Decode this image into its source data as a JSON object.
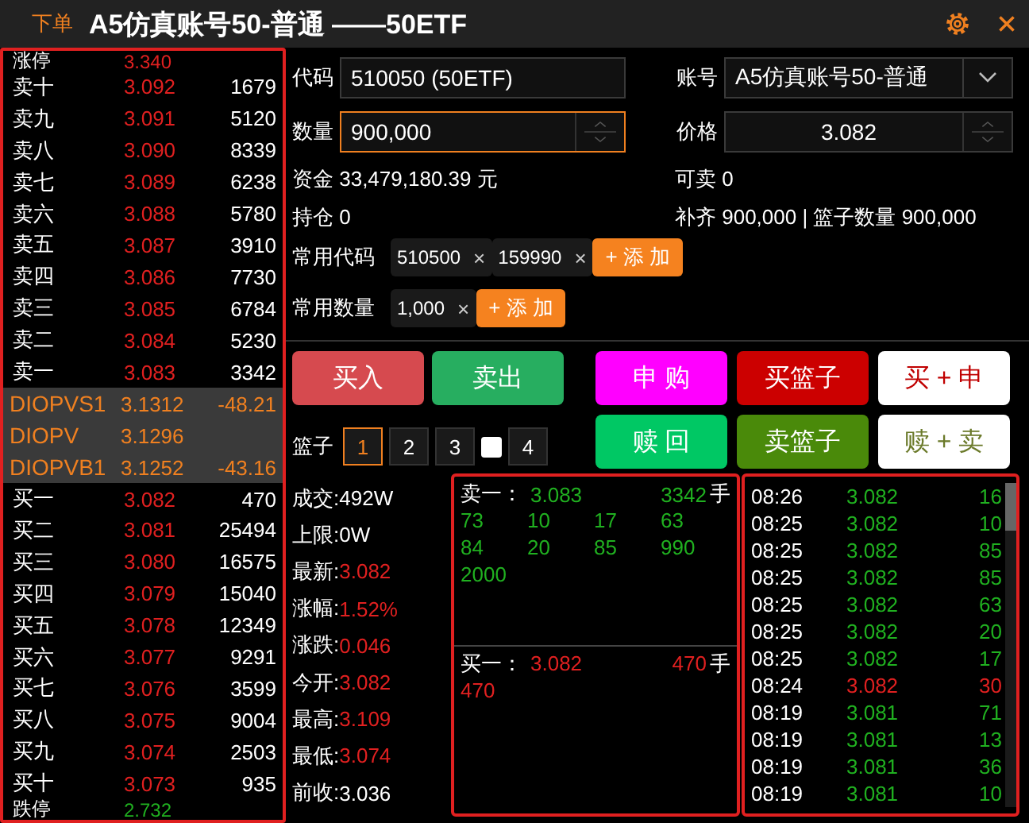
{
  "window": {
    "menu": "下单",
    "title": "A5仿真账号50-普通 ——50ETF"
  },
  "order_book": {
    "limit_up": {
      "label": "涨停",
      "price": "3.340",
      "color": "#e02020"
    },
    "asks": [
      {
        "label": "卖十",
        "price": "3.092",
        "volume": "1679"
      },
      {
        "label": "卖九",
        "price": "3.091",
        "volume": "5120"
      },
      {
        "label": "卖八",
        "price": "3.090",
        "volume": "8339"
      },
      {
        "label": "卖七",
        "price": "3.089",
        "volume": "6238"
      },
      {
        "label": "卖六",
        "price": "3.088",
        "volume": "5780"
      },
      {
        "label": "卖五",
        "price": "3.087",
        "volume": "3910"
      },
      {
        "label": "卖四",
        "price": "3.086",
        "volume": "7730"
      },
      {
        "label": "卖三",
        "price": "3.085",
        "volume": "6784"
      },
      {
        "label": "卖二",
        "price": "3.084",
        "volume": "5230"
      },
      {
        "label": "卖一",
        "price": "3.083",
        "volume": "3342"
      }
    ],
    "iopv": [
      {
        "label": "DIOPVS1",
        "value": "3.1312",
        "diff": "-48.21"
      },
      {
        "label": "DIOPV",
        "value": "3.1296"
      },
      {
        "label": "DIOPVB1",
        "value": "3.1252",
        "diff": "-43.16"
      }
    ],
    "bids": [
      {
        "label": "买一",
        "price": "3.082",
        "volume": "470"
      },
      {
        "label": "买二",
        "price": "3.081",
        "volume": "25494"
      },
      {
        "label": "买三",
        "price": "3.080",
        "volume": "16575"
      },
      {
        "label": "买四",
        "price": "3.079",
        "volume": "15040"
      },
      {
        "label": "买五",
        "price": "3.078",
        "volume": "12349"
      },
      {
        "label": "买六",
        "price": "3.077",
        "volume": "9291"
      },
      {
        "label": "买七",
        "price": "3.076",
        "volume": "3599"
      },
      {
        "label": "买八",
        "price": "3.075",
        "volume": "9004"
      },
      {
        "label": "买九",
        "price": "3.074",
        "volume": "2503"
      },
      {
        "label": "买十",
        "price": "3.073",
        "volume": "935"
      }
    ],
    "limit_down": {
      "label": "跌停",
      "price": "2.732",
      "color": "#20b020"
    }
  },
  "form": {
    "code": {
      "label": "代码",
      "value": "510050 (50ETF)"
    },
    "account": {
      "label": "账号",
      "value": "A5仿真账号50-普通"
    },
    "quantity": {
      "label": "数量",
      "value": "900,000",
      "focused": true
    },
    "price": {
      "label": "价格",
      "value": "3.082",
      "focused": false
    },
    "info": [
      "资金 33,479,180.39 元",
      "可卖 0",
      "持仓 0",
      "补齐 900,000 | 篮子数量 900,000"
    ],
    "common_codes": {
      "label": "常用代码",
      "chips": [
        {
          "value": "510500",
          "remove": "×"
        },
        {
          "value": "159990",
          "remove": "×"
        }
      ],
      "add": "+ 添 加"
    },
    "common_quantities": {
      "label": "常用数量",
      "chips": [
        {
          "value": "1,000",
          "remove": "×"
        }
      ],
      "add": "+ 添 加"
    }
  },
  "actions": [
    {
      "kind": "solid",
      "label": "买入",
      "color": "#d64a4f"
    },
    {
      "kind": "solid",
      "label": "卖出",
      "color": "#27ae60"
    }
  ],
  "etf_actions": [
    {
      "kind": "solid",
      "label": "申 购",
      "color": "#ff00ff"
    },
    {
      "kind": "solid",
      "label": "买篮子",
      "color": "#cc0000"
    },
    {
      "kind": "light",
      "label": "买 + 申",
      "color": "#c00000"
    },
    {
      "kind": "solid",
      "label": "赎 回",
      "color": "#00c864"
    },
    {
      "kind": "solid",
      "label": "卖篮子",
      "color": "#4a8a0a"
    },
    {
      "kind": "light",
      "label": "赎 + 卖",
      "color": "#6b7a2a"
    }
  ],
  "basket": {
    "label": "篮子",
    "items": [
      {
        "kind": "tab",
        "label": "1",
        "selected": true
      },
      {
        "kind": "tab",
        "label": "2",
        "selected": false
      },
      {
        "kind": "tab",
        "label": "3",
        "selected": false
      },
      {
        "kind": "checkbox",
        "checked": false
      },
      {
        "kind": "tab",
        "label": "4",
        "selected": false
      }
    ]
  },
  "stats": [
    {
      "label": "成交:",
      "value": "492W",
      "color": "#ffffff"
    },
    {
      "label": "上限:",
      "value": "0W",
      "color": "#ffffff"
    },
    {
      "label": "最新:",
      "value": "3.082",
      "color": "#e02020"
    },
    {
      "label": "涨幅:",
      "value": "1.52%",
      "color": "#e02020"
    },
    {
      "label": "涨跌:",
      "value": "0.046",
      "color": "#e02020"
    },
    {
      "label": "今开:",
      "value": "3.082",
      "color": "#e02020"
    },
    {
      "label": "最高:",
      "value": "3.109",
      "color": "#e02020"
    },
    {
      "label": "最低:",
      "value": "3.074",
      "color": "#e02020"
    },
    {
      "label": "前收:",
      "value": "3.036",
      "color": "#ffffff"
    }
  ],
  "queues": [
    {
      "kind": "ask",
      "label": "卖一：",
      "price": "3.083",
      "volume": "3342",
      "unit": "手",
      "orders": [
        "73",
        "10",
        "17",
        "63",
        "84",
        "20",
        "85",
        "990",
        "2000"
      ]
    },
    {
      "kind": "bid",
      "label": "买一：",
      "price": "3.082",
      "volume": "470",
      "unit": "手",
      "orders": [
        "470"
      ]
    }
  ],
  "trades": [
    {
      "time": "08:26",
      "price": "3.082",
      "volume": "16",
      "color": "#20b020"
    },
    {
      "time": "08:25",
      "price": "3.082",
      "volume": "10",
      "color": "#20b020"
    },
    {
      "time": "08:25",
      "price": "3.082",
      "volume": "85",
      "color": "#20b020"
    },
    {
      "time": "08:25",
      "price": "3.082",
      "volume": "85",
      "color": "#20b020"
    },
    {
      "time": "08:25",
      "price": "3.082",
      "volume": "63",
      "color": "#20b020"
    },
    {
      "time": "08:25",
      "price": "3.082",
      "volume": "20",
      "color": "#20b020"
    },
    {
      "time": "08:25",
      "price": "3.082",
      "volume": "17",
      "color": "#20b020"
    },
    {
      "time": "08:24",
      "price": "3.082",
      "volume": "30",
      "color": "#e02020"
    },
    {
      "time": "08:19",
      "price": "3.081",
      "volume": "71",
      "color": "#20b020"
    },
    {
      "time": "08:19",
      "price": "3.081",
      "volume": "13",
      "color": "#20b020"
    },
    {
      "time": "08:19",
      "price": "3.081",
      "volume": "36",
      "color": "#20b020"
    },
    {
      "time": "08:19",
      "price": "3.081",
      "volume": "10",
      "color": "#20b020"
    }
  ]
}
